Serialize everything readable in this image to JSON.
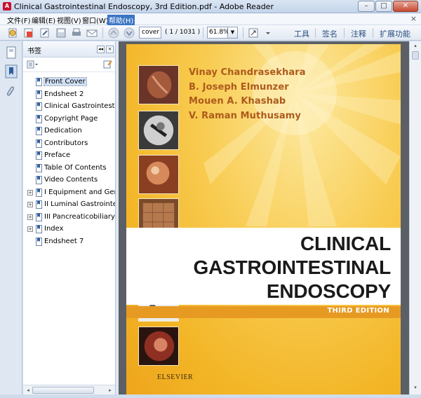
{
  "window": {
    "title": "Clinical Gastrointestinal Endoscopy, 3rd Edition.pdf - Adobe Reader",
    "buttons": {
      "minimize": "–",
      "maximize": "□",
      "close": "✕"
    }
  },
  "menubar": {
    "items": [
      "文件(F)",
      "编辑(E)",
      "视图(V)",
      "窗口(W)",
      "帮助(H)"
    ],
    "close_label": "×"
  },
  "toolbar": {
    "page_value": "cover",
    "page_count": "( 1 / 1031 )",
    "zoom_value": "61.8%",
    "zoom_dropdown": "▼",
    "tools_label": "工具",
    "sign_label": "签名",
    "comment_label": "注释",
    "extend_label": "扩展功能"
  },
  "panel": {
    "title": "书签",
    "collapse": "◂◂",
    "close": "×",
    "options_icon": "bookmark-options-icon",
    "bookmarks": [
      {
        "label": "Front Cover",
        "expandable": false,
        "selected": true
      },
      {
        "label": "Endsheet 2",
        "expandable": false,
        "selected": false
      },
      {
        "label": "Clinical Gastrointestinal Endoscopy",
        "expandable": false,
        "selected": false
      },
      {
        "label": "Copyright Page",
        "expandable": false,
        "selected": false
      },
      {
        "label": "Dedication",
        "expandable": false,
        "selected": false
      },
      {
        "label": "Contributors",
        "expandable": false,
        "selected": false
      },
      {
        "label": "Preface",
        "expandable": false,
        "selected": false
      },
      {
        "label": "Table Of Contents",
        "expandable": false,
        "selected": false
      },
      {
        "label": "Video Contents",
        "expandable": false,
        "selected": false
      },
      {
        "label": "I Equipment and General",
        "expandable": true,
        "selected": false
      },
      {
        "label": "II Luminal Gastrointestinal",
        "expandable": true,
        "selected": false
      },
      {
        "label": "III Pancreaticobiliary Disorders",
        "expandable": true,
        "selected": false
      },
      {
        "label": "Index",
        "expandable": true,
        "selected": false
      },
      {
        "label": "Endsheet 7",
        "expandable": false,
        "selected": false
      }
    ]
  },
  "cover": {
    "authors": [
      "Vinay Chandrasekhara",
      "B. Joseph Elmunzer",
      "Mouen A. Khashab",
      "V. Raman Muthusamy"
    ],
    "title_lines": [
      "CLINICAL",
      "GASTROINTESTINAL",
      "ENDOSCOPY"
    ],
    "edition": "THIRD EDITION",
    "publisher": "ELSEVIER",
    "colors": {
      "background": "#f3b526",
      "author": "#ad5a1c",
      "band": "#e79a22"
    }
  }
}
